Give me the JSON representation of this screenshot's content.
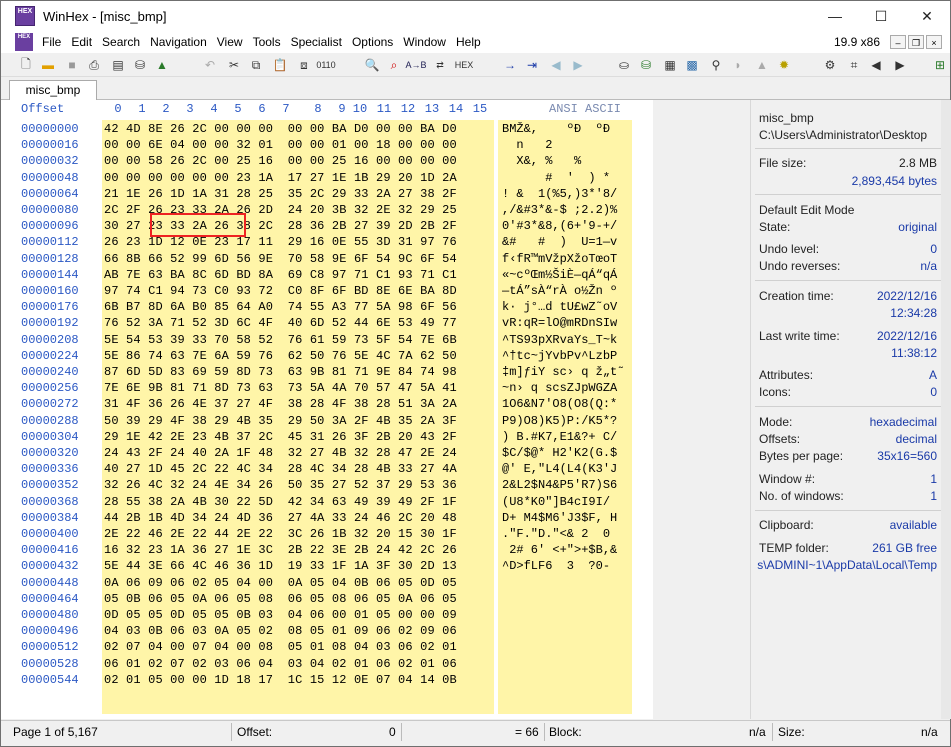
{
  "window": {
    "title": "WinHex - [misc_bmp]",
    "app_icon": "HEX",
    "min": "—",
    "max": "☐",
    "close": "✕"
  },
  "menu": {
    "items": [
      "File",
      "Edit",
      "Search",
      "Navigation",
      "View",
      "Tools",
      "Specialist",
      "Options",
      "Window",
      "Help"
    ],
    "version": "19.9 x86"
  },
  "tab": {
    "label": "misc_bmp"
  },
  "hex": {
    "offset_label": "Offset",
    "ansi_label": "ANSI ASCII",
    "columns": [
      "0",
      "1",
      "2",
      "3",
      "4",
      "5",
      "6",
      "7",
      "8",
      "9",
      "10",
      "11",
      "12",
      "13",
      "14",
      "15"
    ],
    "offsets": [
      "00000000",
      "00000016",
      "00000032",
      "00000048",
      "00000064",
      "00000080",
      "00000096",
      "00000112",
      "00000128",
      "00000144",
      "00000160",
      "00000176",
      "00000192",
      "00000208",
      "00000224",
      "00000240",
      "00000256",
      "00000272",
      "00000288",
      "00000304",
      "00000320",
      "00000336",
      "00000352",
      "00000368",
      "00000384",
      "00000400",
      "00000416",
      "00000432",
      "00000448",
      "00000464",
      "00000480",
      "00000496",
      "00000512",
      "00000528",
      "00000544"
    ],
    "rows": [
      "42 4D 8E 26 2C 00 00 00  00 00 BA D0 00 00 BA D0",
      "00 00 6E 04 00 00 32 01  00 00 01 00 18 00 00 00",
      "00 00 58 26 2C 00 25 16  00 00 25 16 00 00 00 00",
      "00 00 00 00 00 00 23 1A  17 27 1E 1B 29 20 1D 2A",
      "21 1E 26 1D 1A 31 28 25  35 2C 29 33 2A 27 38 2F",
      "2C 2F 26 23 33 2A 26 2D  24 20 3B 32 2E 32 29 25",
      "30 27 23 33 2A 26 38 2C  28 36 2B 27 39 2D 2B 2F",
      "26 23 1D 12 0E 23 17 11  29 16 0E 55 3D 31 97 76",
      "66 8B 66 52 99 6D 56 9E  70 58 9E 6F 54 9C 6F 54",
      "AB 7E 63 BA 8C 6D BD 8A  69 C8 97 71 C1 93 71 C1",
      "97 74 C1 94 73 C0 93 72  C0 8F 6F BD 8E 6E BA 8D",
      "6B B7 8D 6A B0 85 64 A0  74 55 A3 77 5A 98 6F 56",
      "76 52 3A 71 52 3D 6C 4F  40 6D 52 44 6E 53 49 77",
      "5E 54 53 39 33 70 58 52  76 61 59 73 5F 54 7E 6B",
      "5E 86 74 63 7E 6A 59 76  62 50 76 5E 4C 7A 62 50",
      "87 6D 5D 83 69 59 8D 73  63 9B 81 71 9E 84 74 98",
      "7E 6E 9B 81 71 8D 73 63  73 5A 4A 70 57 47 5A 41",
      "31 4F 36 26 4E 37 27 4F  38 28 4F 38 28 51 3A 2A",
      "50 39 29 4F 38 29 4B 35  29 50 3A 2F 4B 35 2A 3F",
      "29 1E 42 2E 23 4B 37 2C  45 31 26 3F 2B 20 43 2F",
      "24 43 2F 24 40 2A 1F 48  32 27 4B 32 28 47 2E 24",
      "40 27 1D 45 2C 22 4C 34  28 4C 34 28 4B 33 27 4A",
      "32 26 4C 32 24 4E 34 26  50 35 27 52 37 29 53 36",
      "28 55 38 2A 4B 30 22 5D  42 34 63 49 39 49 2F 1F",
      "44 2B 1B 4D 34 24 4D 36  27 4A 33 24 46 2C 20 48",
      "2E 22 46 2E 22 44 2E 22  3C 26 1B 32 20 15 30 1F",
      "16 32 23 1A 36 27 1E 3C  2B 22 3E 2B 24 42 2C 26",
      "5E 44 3E 66 4C 46 36 1D  19 33 1F 1A 3F 30 2D 13",
      "0A 06 09 06 02 05 04 00  0A 05 04 0B 06 05 0D 05",
      "05 0B 06 05 0A 06 05 08  06 05 08 06 05 0A 06 05",
      "0D 05 05 0D 05 05 0B 03  04 06 00 01 05 00 00 09",
      "04 03 0B 06 03 0A 05 02  08 05 01 09 06 02 09 06",
      "02 07 04 00 07 04 00 08  05 01 08 04 03 06 02 01",
      "06 01 02 07 02 03 06 04  03 04 02 01 06 02 01 06",
      "02 01 05 00 00 1D 18 17  1C 15 12 0E 07 04 14 0B"
    ],
    "ansi": [
      "BMŽ&,    ºÐ  ºÐ",
      "  n   2         ",
      "  X&, %   %     ",
      "      #  '  ) *",
      "! &  1(%5,)3*'8/",
      ",/&#3*&-$ ;2.2)%",
      "0'#3*&8,(6+'9-+/",
      "&#   #  )  U=1—v",
      "f‹fR™mVžpXžoTœoT",
      "«~cºŒm½ŠiÈ—qÁ“qÁ",
      "—tÁ”sÀ“rÀ o½Žn º",
      "k· j°…d tU£wZ˜oV",
      "vR:qR=lO@mRDnSIw",
      "^TS93pXRvaYs_T~k",
      "^†tc~jYvbPv^LzbP",
      "‡m]ƒiY sc› q ž„t˜",
      "~n› q scsZJpWGZA",
      "1O6&N7'O8(O8(Q:*",
      "P9)O8)K5)P:/K5*?",
      ") B.#K7,E1&?+ C/",
      "$C/$@* H2'K2(G.$",
      "@' E,\"L4(L4(K3'J",
      "2&L2$N4&P5'R7)S6",
      "(U8*K0\"]B4cI9I/",
      "D+ M4$M6'J3$F, H",
      ".\"F.\"D.\"<& 2  0",
      " 2# 6' <+\">+$B,&",
      "^D>fLF6  3  ?0-",
      "",
      "",
      "",
      "",
      "",
      "",
      ""
    ]
  },
  "info": {
    "filename": "misc_bmp",
    "path": "C:\\Users\\Administrator\\Desktop",
    "file_size_label": "File size:",
    "file_size_mb": "2.8 MB",
    "file_size_bytes": "2,893,454 bytes",
    "edit_mode_label": "Default Edit Mode",
    "state_label": "State:",
    "state_value": "original",
    "undo_level_label": "Undo level:",
    "undo_level_value": "0",
    "undo_reverses_label": "Undo reverses:",
    "undo_reverses_value": "n/a",
    "creation_label": "Creation time:",
    "creation_date": "2022/12/16",
    "creation_time": "12:34:28",
    "lastwrite_label": "Last write time:",
    "lastwrite_date": "2022/12/16",
    "lastwrite_time": "11:38:12",
    "attributes_label": "Attributes:",
    "attributes_value": "A",
    "icons_label": "Icons:",
    "icons_value": "0",
    "mode_label": "Mode:",
    "mode_value": "hexadecimal",
    "offsets_label": "Offsets:",
    "offsets_value": "decimal",
    "bpp_label": "Bytes per page:",
    "bpp_value": "35x16=560",
    "windownum_label": "Window #:",
    "windownum_value": "1",
    "numwindows_label": "No. of windows:",
    "numwindows_value": "1",
    "clipboard_label": "Clipboard:",
    "clipboard_value": "available",
    "temp_label": "TEMP folder:",
    "temp_value": "261 GB free",
    "temp_path": "s\\ADMINI~1\\AppData\\Local\\Temp"
  },
  "status": {
    "page": "Page 1 of 5,167",
    "offset_label": "Offset:",
    "offset_value": "0",
    "eq_value": "= 66",
    "block_label": "Block:",
    "block_value": "n/a",
    "size_label": "Size:",
    "size_value": "n/a"
  },
  "colors": {
    "accent": "#2b58c4",
    "hex_bg": "#fff5a8",
    "highlight": "#e22222"
  }
}
